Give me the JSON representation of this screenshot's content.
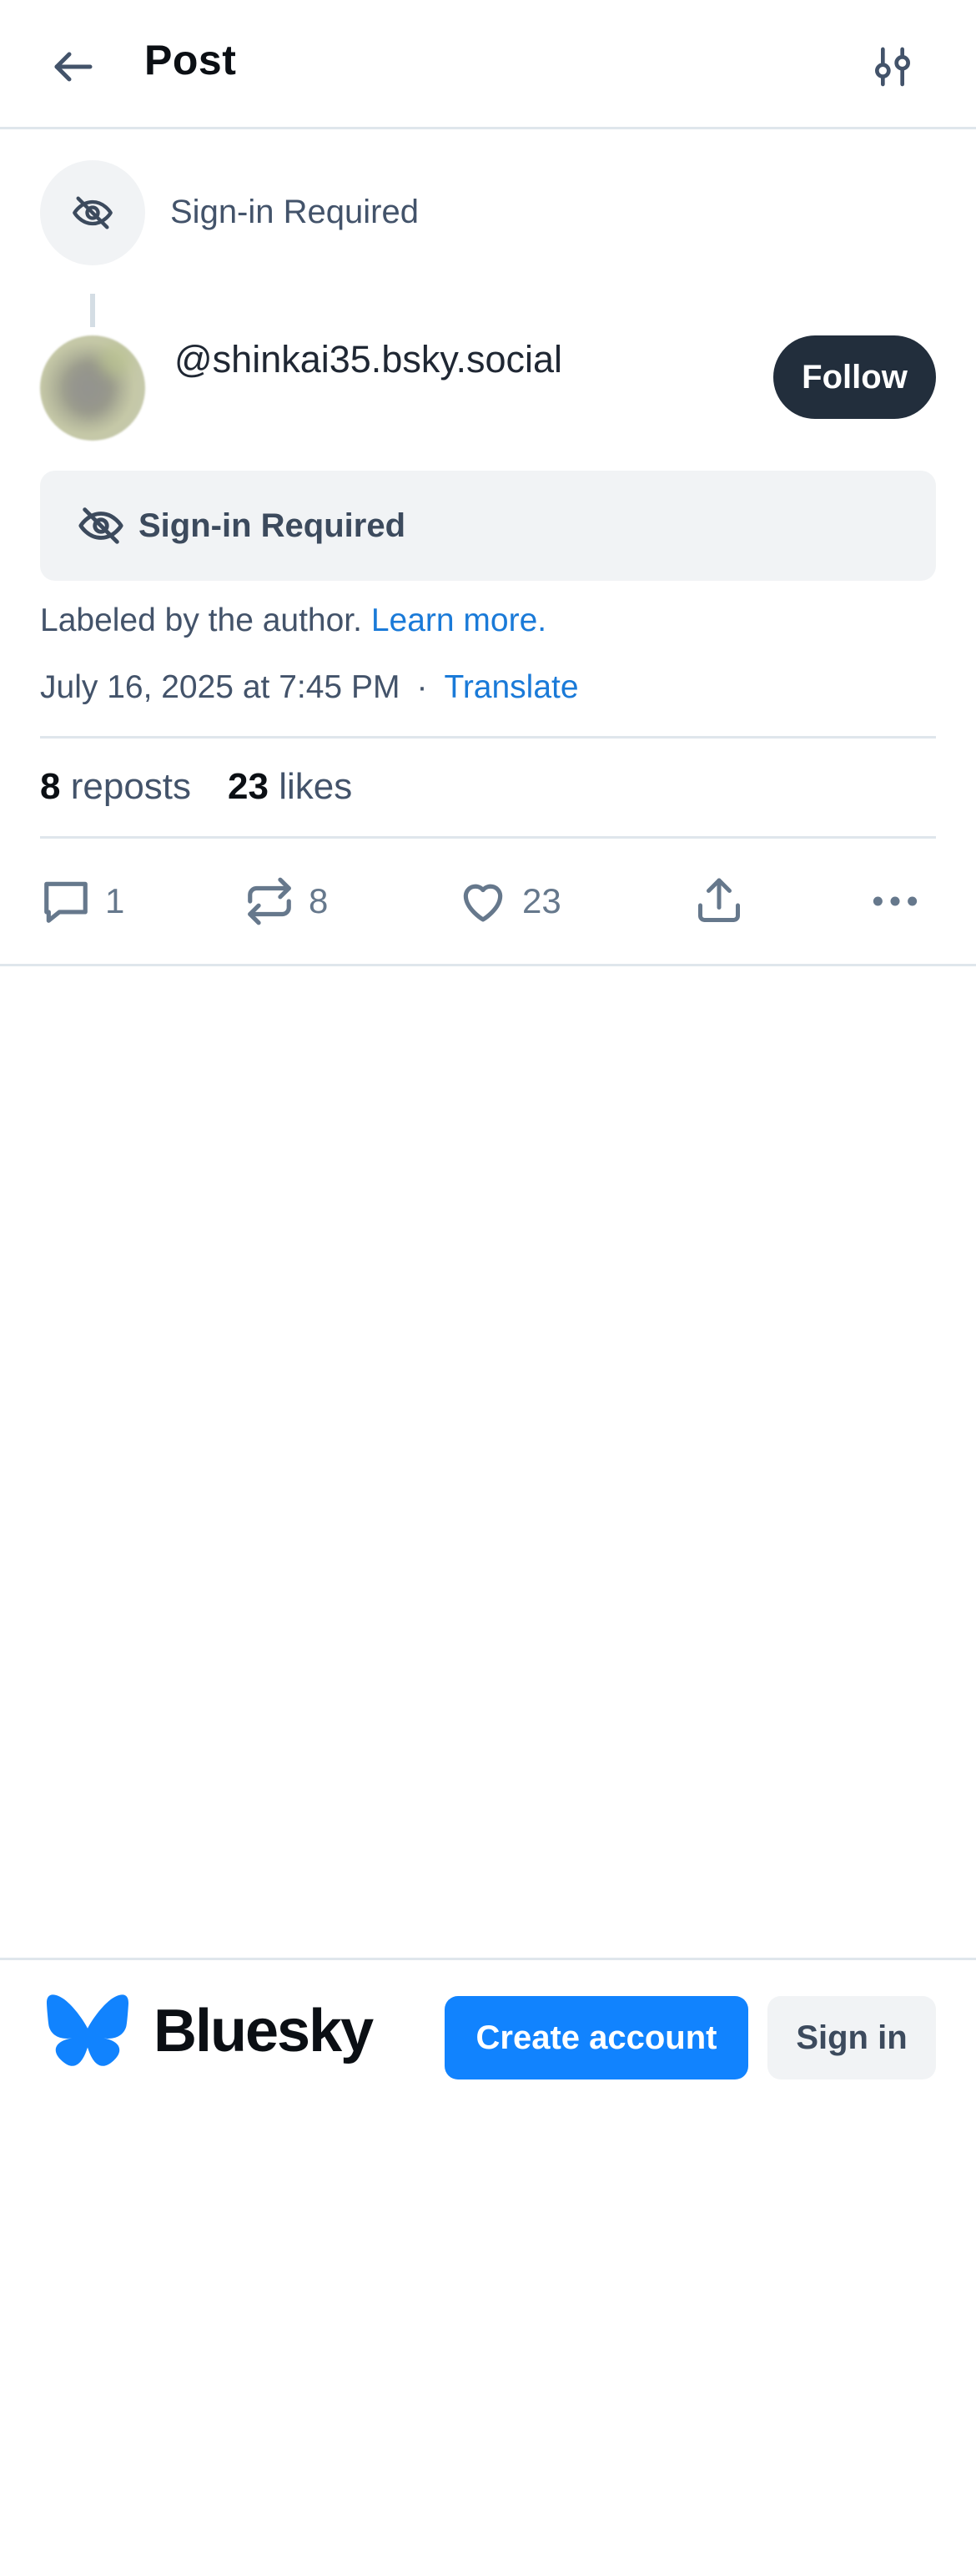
{
  "header": {
    "title": "Post",
    "back_icon": "arrow-left-icon",
    "filter_icon": "sliders-icon"
  },
  "parent_post": {
    "label": "Sign-in Required",
    "icon": "eye-slash-icon"
  },
  "post": {
    "author_handle": "@shinkai35.bsky.social",
    "follow_label": "Follow",
    "content_warning": "Sign-in Required",
    "label_text": "Labeled by the author.",
    "learn_more": "Learn more.",
    "date": "July 16, 2025 at 7:45 PM",
    "separator": "·",
    "translate": "Translate",
    "stats": {
      "reposts_count": "8",
      "reposts_label": "reposts",
      "likes_count": "23",
      "likes_label": "likes"
    },
    "actions": {
      "reply_count": "1",
      "repost_count": "8",
      "like_count": "23"
    }
  },
  "footer": {
    "brand_name": "Bluesky",
    "create_account": "Create account",
    "sign_in": "Sign in"
  },
  "colors": {
    "accent": "#1183fe",
    "link": "#1a7ad8",
    "follow_bg": "#222e3c",
    "muted_text": "#43536a"
  }
}
